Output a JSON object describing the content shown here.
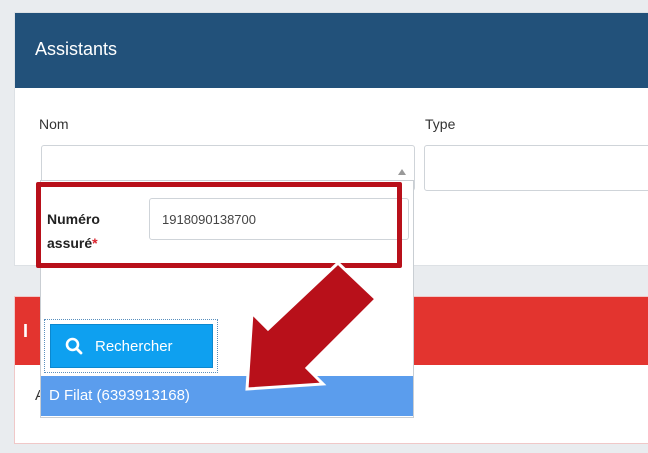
{
  "panel": {
    "title": "Assistants",
    "fields": [
      {
        "label": "Nom"
      },
      {
        "label": "Type"
      }
    ]
  },
  "panel2": {
    "title_partial": "I",
    "text_partial": "A"
  },
  "dropdown": {
    "label": "Numéro assuré",
    "required_mark": "*",
    "input_value": "1918090138700",
    "search_button": "Rechercher",
    "result": "D Filat (6393913168)"
  },
  "colors": {
    "header_blue": "#22517a",
    "red_header": "#e3342f",
    "button_blue": "#0ea0f0",
    "result_highlight": "#5b9ded",
    "annotation_red": "#b8101a"
  },
  "icons": {
    "search": "search-icon",
    "caret": "caret-up-icon",
    "arrow": "annotation-arrow-icon"
  }
}
